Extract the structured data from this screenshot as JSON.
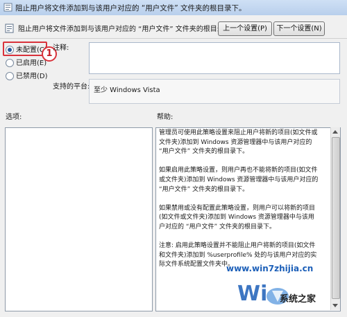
{
  "window": {
    "title": "阻止用户将文件添加到与该用户对应的 “用户文件” 文件夹的根目录下。",
    "heading": "阻止用户将文件添加到与该用户对应的 “用户文件” 文件夹的根目录下。",
    "prev_button": "上一个设置(P)",
    "next_button": "下一个设置(N)"
  },
  "state_options": [
    {
      "label": "未配置(C)",
      "selected": true
    },
    {
      "label": "已启用(E)",
      "selected": false
    },
    {
      "label": "已禁用(D)",
      "selected": false
    }
  ],
  "annotation_marker": "1",
  "comment": {
    "label": "注释:",
    "value": ""
  },
  "platform": {
    "label": "支持的平台:",
    "value": "至少 Windows Vista"
  },
  "options_label": "选项:",
  "help": {
    "label": "帮助:",
    "paragraphs": [
      "管理员可使用此策略设置来阻止用户将新的项目(如文件或文件夹)添加到 Windows 资源管理器中与该用户对应的 “用户文件” 文件夹的根目录下。",
      "如果启用此策略设置，则用户再也不能将新的项目(如文件或文件夹)添加到 Windows 资源管理器中与该用户对应的 “用户文件” 文件夹的根目录下。",
      "如果禁用或没有配置此策略设置，则用户可以将新的项目(如文件或文件夹)添加到 Windows 资源管理器中与该用户对应的 “用户文件” 文件夹的根目录下。",
      "注意: 启用此策略设置并不能阻止用户将新的项目(如文件和文件夹)添加到 %userprofile% 处的与该用户对应的实际文件系统配置文件夹中。"
    ]
  },
  "watermark": {
    "url": "www.win7zhijia.cn",
    "site": "系统之家"
  },
  "colors": {
    "highlight": "#d9313a",
    "watermark_blue": "#1c5fb8"
  }
}
